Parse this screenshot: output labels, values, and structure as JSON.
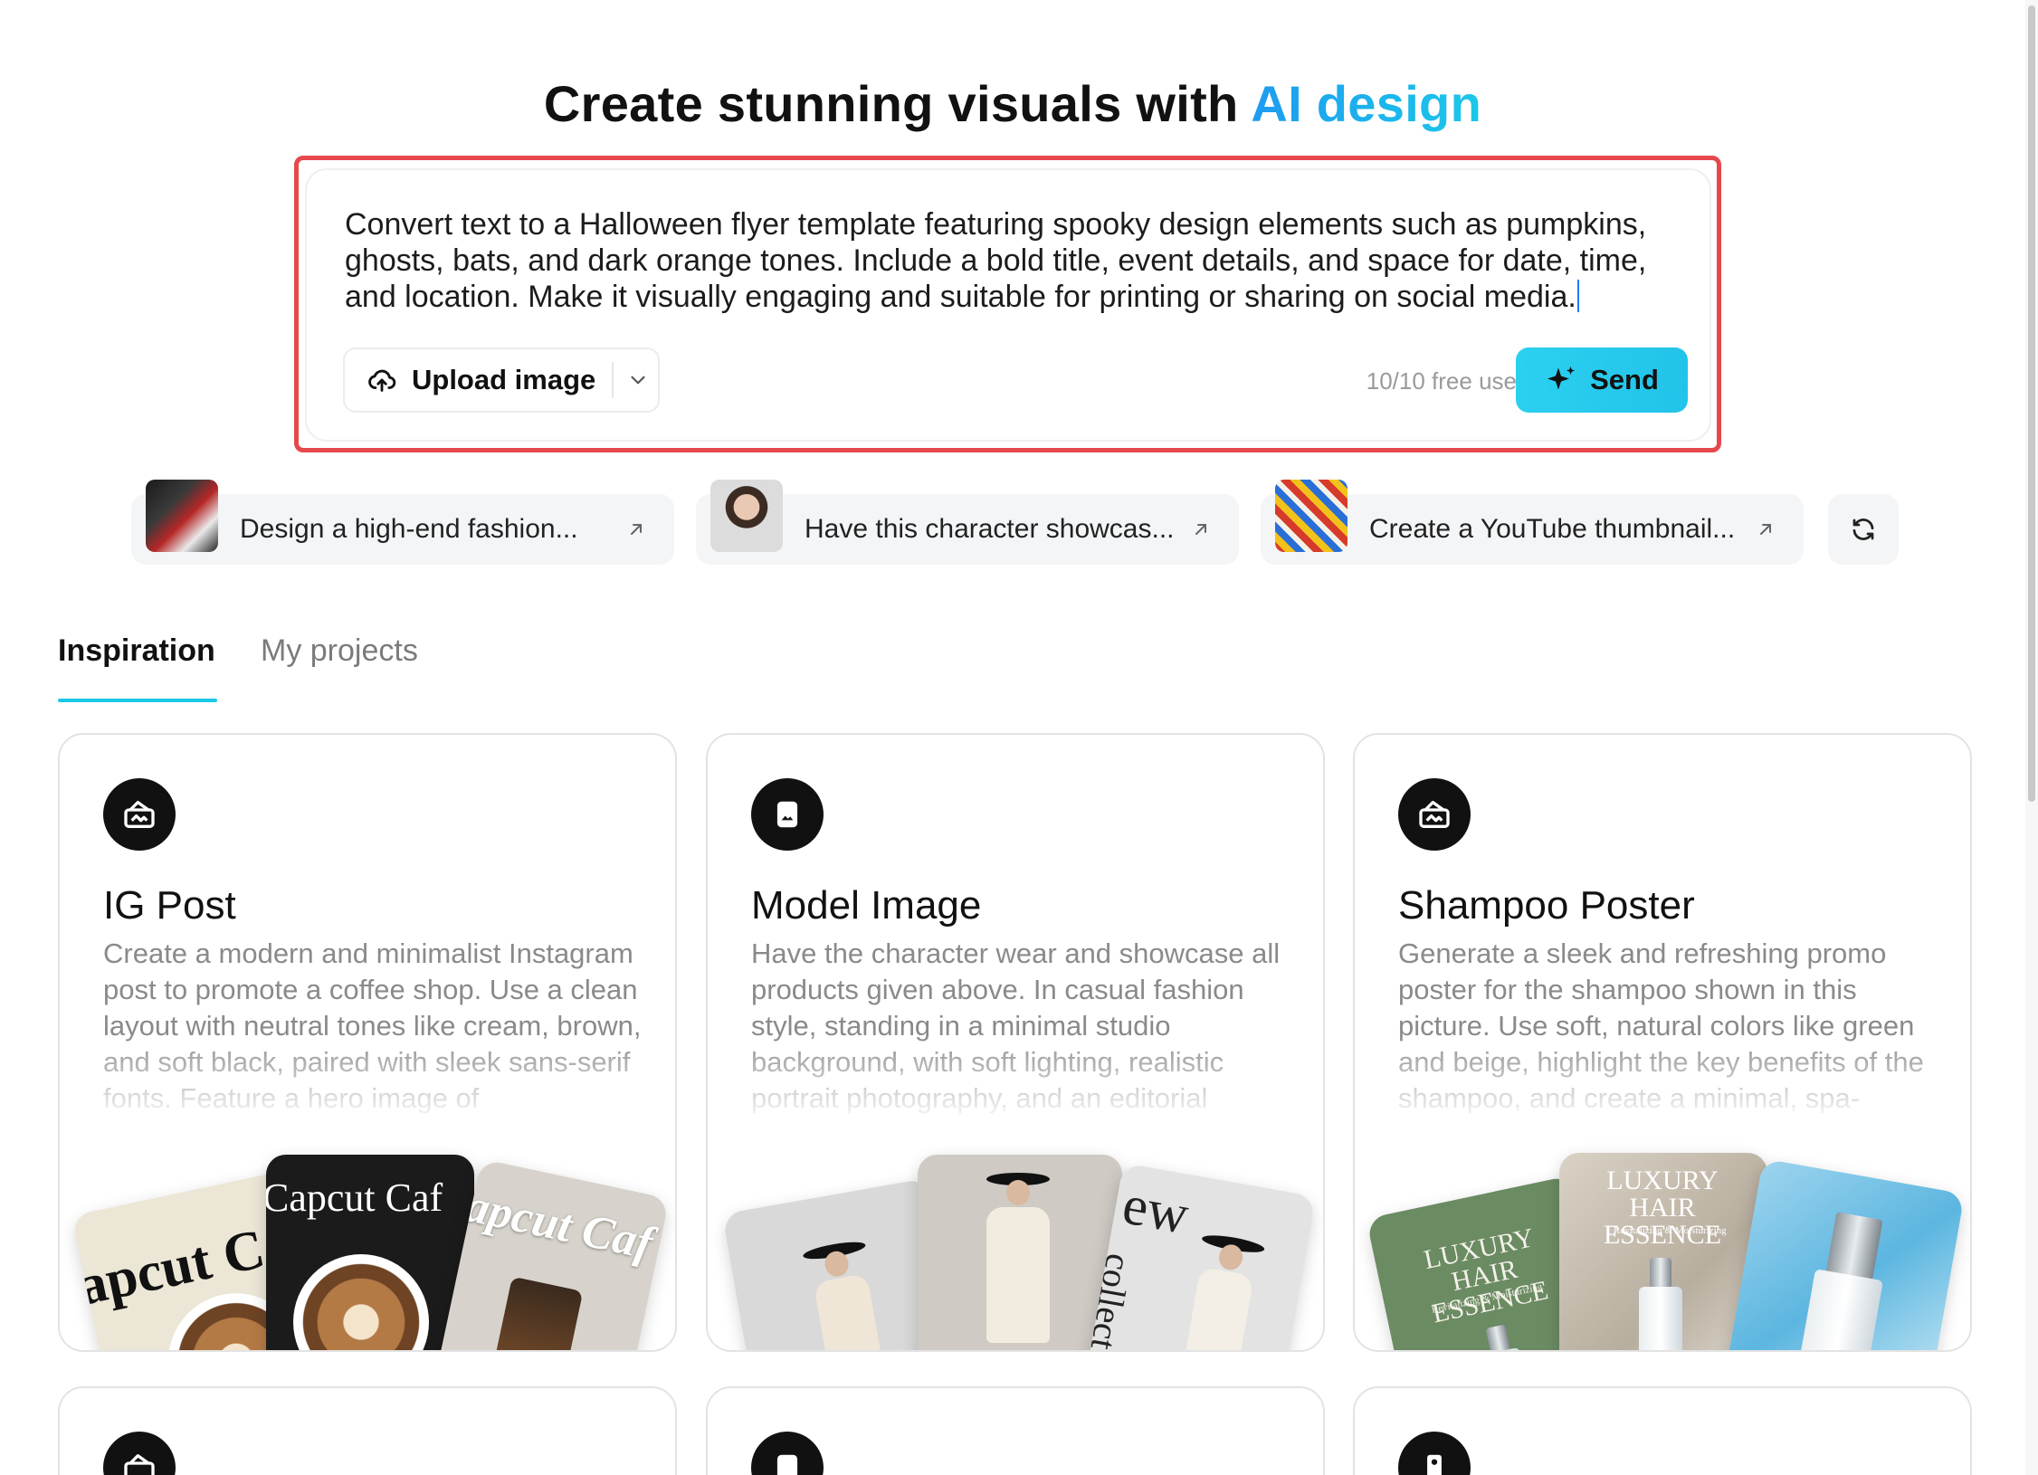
{
  "header": {
    "title_prefix": "Create stunning visuals with ",
    "title_accent": "AI design"
  },
  "prompt": {
    "text": "Convert text to a Halloween flyer template featuring spooky design elements such as pumpkins, ghosts, bats, and dark orange tones. Include a bold title, event details, and space for date, time, and location. Make it visually engaging and suitable for printing or sharing on social media.",
    "upload_label": "Upload image",
    "free_uses": "10/10 free uses",
    "send_label": "Send"
  },
  "suggestions": [
    {
      "label": "Design a high-end fashion...",
      "thumb": "fashion-thumbnail"
    },
    {
      "label": "Have this character showcas...",
      "thumb": "character-thumbnail"
    },
    {
      "label": "Create a YouTube thumbnail...",
      "thumb": "youtube-thumbnail"
    }
  ],
  "tabs": {
    "inspiration": "Inspiration",
    "projects": "My projects"
  },
  "cards": [
    {
      "title": "IG Post",
      "icon": "image-card-icon",
      "desc": "Create a modern and minimalist Instagram post to promote a coffee shop. Use a clean layout with neutral tones like cream, brown, and soft black, paired with sleek sans-serif fonts. Feature a hero image of",
      "tile_text_1": "apcut C",
      "tile_text_2": "Capcut Caf",
      "tile_text_3": "apcut Caf"
    },
    {
      "title": "Model Image",
      "icon": "document-image-icon",
      "desc": "Have the character wear and showcase all products given above. In casual fashion style, standing in a minimal studio background, with soft lighting, realistic portrait photography, and an editorial",
      "tile_text_3": "ew",
      "tile_text_4": "collect"
    },
    {
      "title": "Shampoo Poster",
      "icon": "image-card-icon",
      "desc": "Generate a sleek and refreshing promo poster for the shampoo shown in this picture. Use soft, natural colors like green and beige, highlight the key benefits of the shampoo, and create a minimal, spa-",
      "tile_text_1": "LUXURY HAIR ESSENCE",
      "tile_sub_1": "Revitalizing & Moisturizing",
      "tile_text_2": "LUXURY HAIR ESSENCE",
      "tile_sub_2": "Revitalizing & Moisturizing"
    }
  ],
  "colors": {
    "accent_start": "#1e9bf0",
    "accent_end": "#1cc8e8",
    "send_button": "#22c3ea",
    "highlight_border": "#e5484d"
  }
}
